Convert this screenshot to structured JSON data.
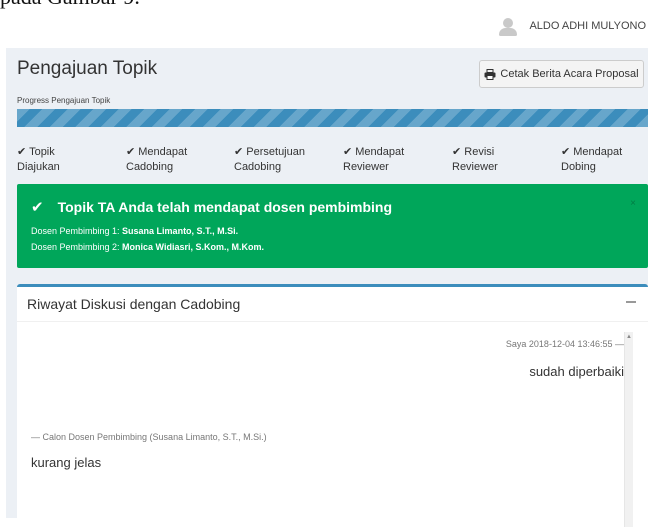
{
  "document": {
    "top_text": "pada Gambar 9."
  },
  "header": {
    "user_name": "ALDO ADHI MULYONO",
    "user_icon": "user-avatar-icon"
  },
  "page": {
    "title": "Pengajuan Topik",
    "print_button_label": "Cetak Berita Acara Proposal",
    "print_icon": "printer-icon"
  },
  "progress": {
    "label": "Progress Pengajuan Topik",
    "percent": 100,
    "color": "#3c8dbc",
    "steps": [
      {
        "line1": "✔ Topik",
        "line2": "Diajukan"
      },
      {
        "line1": "✔ Mendapat",
        "line2": "Cadobing"
      },
      {
        "line1": "✔ Persetujuan",
        "line2": "Cadobing"
      },
      {
        "line1": "✔ Mendapat",
        "line2": "Reviewer"
      },
      {
        "line1": "✔ Revisi",
        "line2": "Reviewer"
      },
      {
        "line1": "✔ Mendapat",
        "line2": "Dobing"
      }
    ]
  },
  "alert": {
    "color": "#00a65a",
    "title": "Topik TA Anda telah mendapat dosen pembimbing",
    "check_icon": "check-icon",
    "line1_label": "Dosen Pembimbing 1: ",
    "line1_value": "Susana Limanto, S.T., M.Si.",
    "line2_label": "Dosen Pembimbing 2: ",
    "line2_value": "Monica Widiasri, S.Kom., M.Kom.",
    "close_label": "×"
  },
  "discussion": {
    "title": "Riwayat Diskusi dengan Cadobing",
    "collapse_icon": "minus-icon",
    "messages": [
      {
        "meta": "Saya 2018-12-04 13:46:55 —",
        "text": "sudah diperbaiki",
        "side": "right"
      },
      {
        "meta": "— Calon Dosen Pembimbing (Susana Limanto, S.T., M.Si.)",
        "text": "kurang jelas",
        "side": "left"
      }
    ]
  }
}
